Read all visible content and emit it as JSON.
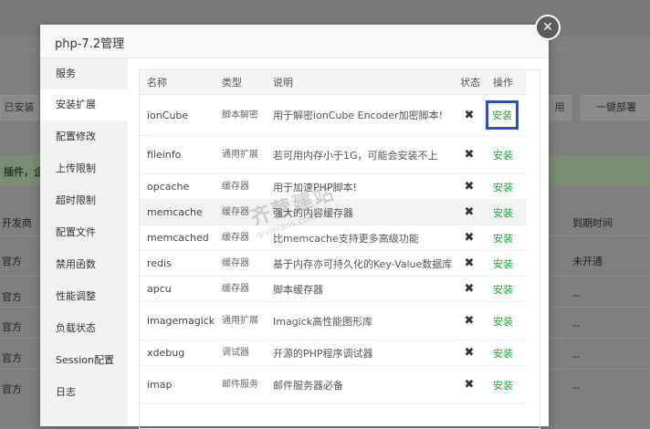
{
  "background": {
    "toolbar": {
      "installed_label": "已安装",
      "right_partial": "用",
      "one_click_deploy": "一键部署"
    },
    "notice_text": "插件，企",
    "table": {
      "header_left": "开发商",
      "header_right": "到期时间",
      "rows": [
        {
          "left": "官方",
          "right": "未开通"
        },
        {
          "left": "官方",
          "right": "--"
        },
        {
          "left": "官方",
          "right": "--"
        },
        {
          "left": "官方",
          "right": "--"
        },
        {
          "left": "官方",
          "right": "--"
        }
      ]
    }
  },
  "modal": {
    "title": "php-7.2管理",
    "close_icon": "close-icon",
    "sidebar": {
      "items": [
        {
          "label": "服务"
        },
        {
          "label": "安装扩展"
        },
        {
          "label": "配置修改"
        },
        {
          "label": "上传限制"
        },
        {
          "label": "超时限制"
        },
        {
          "label": "配置文件"
        },
        {
          "label": "禁用函数"
        },
        {
          "label": "性能调整"
        },
        {
          "label": "负载状态"
        },
        {
          "label": "Session配置"
        },
        {
          "label": "日志"
        }
      ]
    },
    "table": {
      "headers": {
        "name": "名称",
        "type": "类型",
        "desc": "说明",
        "status": "状态",
        "op": "操作"
      },
      "status_glyph": "✖",
      "rows": [
        {
          "name": "ionCube",
          "type": "脚本解密",
          "desc": "用于解密ionCube Encoder加密脚本!",
          "op": "安装"
        },
        {
          "name": "fileinfo",
          "type": "通用扩展",
          "desc": "若可用内存小于1G，可能会安装不上",
          "op": "安装"
        },
        {
          "name": "opcache",
          "type": "缓存器",
          "desc": "用于加速PHP脚本!",
          "op": "安装"
        },
        {
          "name": "memcache",
          "type": "缓存器",
          "desc": "强大的内容缓存器",
          "op": "安装"
        },
        {
          "name": "memcached",
          "type": "缓存器",
          "desc": "比memcache支持更多高级功能",
          "op": "安装"
        },
        {
          "name": "redis",
          "type": "缓存器",
          "desc": "基于内存亦可持久化的Key-Value数据库",
          "op": "安装"
        },
        {
          "name": "apcu",
          "type": "缓存器",
          "desc": "脚本缓存器",
          "op": "安装"
        },
        {
          "name": "imagemagick",
          "type": "通用扩展",
          "desc": "Imagick高性能图形库",
          "op": "安装"
        },
        {
          "name": "xdebug",
          "type": "调试器",
          "desc": "开源的PHP程序调试器",
          "op": "安装"
        },
        {
          "name": "imap",
          "type": "邮件服务",
          "desc": "邮件服务器必备",
          "op": "安装"
        }
      ]
    },
    "watermark": {
      "text": "齐营建站",
      "sub": "qiyinlans.com"
    }
  }
}
